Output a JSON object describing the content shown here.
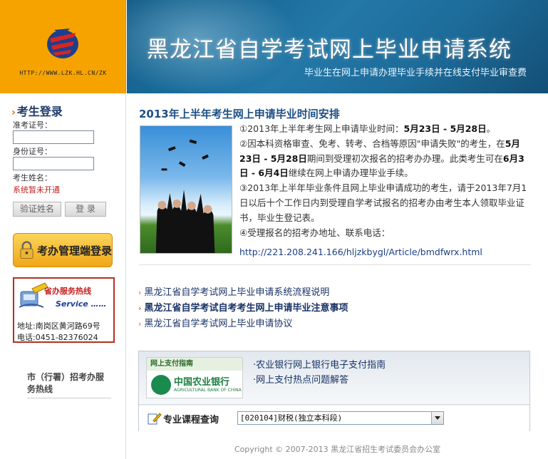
{
  "header": {
    "logo_url": "HTTP://WWW.LZK.HL.CN/ZK",
    "title": "黑龙江省自学考试网上毕业申请系统",
    "subtitle": "毕业生在网上申请办理毕业手续并在线支付毕业审查费"
  },
  "login": {
    "heading": "考生登录",
    "admission_label": "准考证号：",
    "admission_value": "",
    "id_label": "身份证号：",
    "id_value": "",
    "name_label": "考生姓名：",
    "notice": "系统暂未开通",
    "verify_button": "验证姓名",
    "login_button": "登  录"
  },
  "admin_button": "考办管理端登录",
  "hotline": {
    "title": "省办服务热线",
    "service": "Service ……",
    "address": "地址:南岗区黄河路69号",
    "phone": "电话:0451-82376024"
  },
  "city_hotline": "市（行署）招考办服务热线",
  "news": {
    "title": "2013年上半年考生网上申请毕业时间安排",
    "p1_pre": "①2013年上半年考生网上申请毕业时间：",
    "p1_bold": "5月23日 - 5月28日",
    "p1_post": "。",
    "p2_pre": "②因本科资格审查、免考、转考、合档等原因\"申请失败\"的考生，在",
    "p2_bold1": "5月23日 - 5月28日",
    "p2_mid": "期间到受理初次报名的招考办办理。此类考生可在",
    "p2_bold2": "6月3日 - 6月4日",
    "p2_post": "继续在网上申请办理毕业手续。",
    "p3": "③2013年上半年毕业条件且网上毕业申请成功的考生，请于2013年7月1日以后十个工作日内到受理自学考试报名的招考办由考生本人领取毕业证书，毕业生登记表。",
    "p4": "④受理报名的招考办地址、联系电话：",
    "link": "http://221.208.241.166/hljzkbygl/Article/bmdfwrx.html"
  },
  "links": [
    "黑龙江省自学考试网上毕业申请系统流程说明",
    "黑龙江省自学考试自考考生网上申请毕业注意事项",
    "黑龙江省自学考试网上毕业申请协议"
  ],
  "payment": {
    "guide_title": "网上支付指南",
    "bank_cn": "中国农业银行",
    "bank_en": "AGRICULTURAL BANK OF CHINA",
    "link1": "·农业银行网上银行电子支付指南",
    "link2": "·网上支付热点问题解答"
  },
  "course": {
    "label": "专业课程查询",
    "selected": "[020104]财税(独立本科段)"
  },
  "footer": "Copyright © 2007-2013 黑龙江省招生考试委员会办公室",
  "colors": {
    "accent_orange": "#f6a300",
    "banner_blue": "#1d6b99",
    "link_blue": "#1a3366",
    "alert_red": "#c0211f"
  }
}
